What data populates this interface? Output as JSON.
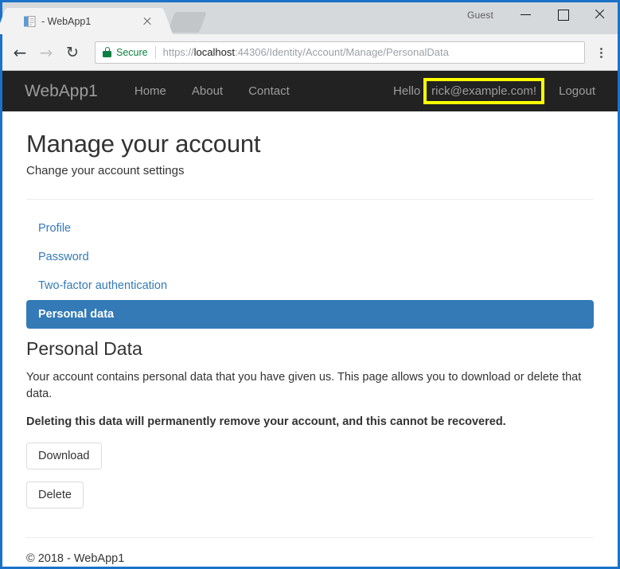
{
  "browser": {
    "tab": {
      "title": "- WebApp1",
      "favicon": "page-icon",
      "close_icon": "close-icon"
    },
    "newtab_icon": "new-tab-button",
    "window": {
      "profile_label": "Guest",
      "minimize_icon": "minimize-icon",
      "maximize_icon": "maximize-icon",
      "close_icon": "close-icon"
    },
    "toolbar": {
      "back_icon": "←",
      "forward_icon": "→",
      "reload_icon": "↻",
      "menu_icon": "overflow-menu-icon",
      "security_label": "Secure",
      "lock_icon": "lock-icon",
      "url_scheme": "https://",
      "url_host": "localhost",
      "url_path": ":44306/Identity/Account/Manage/PersonalData",
      "url_full": "https://localhost:44306/Identity/Account/Manage/PersonalData"
    }
  },
  "site": {
    "navbar": {
      "brand": "WebApp1",
      "links": [
        {
          "label": "Home"
        },
        {
          "label": "About"
        },
        {
          "label": "Contact"
        }
      ],
      "greeting_prefix": "Hello",
      "user_email": "rick@example.com!",
      "logout_label": "Logout",
      "highlight_color": "#ffff00",
      "background_color": "#222222"
    },
    "header": {
      "title": "Manage your account",
      "subtitle": "Change your account settings"
    },
    "manage_nav": {
      "items": [
        {
          "label": "Profile",
          "active": false
        },
        {
          "label": "Password",
          "active": false
        },
        {
          "label": "Two-factor authentication",
          "active": false
        },
        {
          "label": "Personal data",
          "active": true
        }
      ],
      "active_color": "#337ab7",
      "link_color": "#337ab7"
    },
    "main": {
      "section_title": "Personal Data",
      "paragraph": "Your account contains personal data that you have given us. This page allows you to download or delete that data.",
      "warning": "Deleting this data will permanently remove your account, and this cannot be recovered.",
      "download_button": "Download",
      "delete_button": "Delete"
    },
    "footer": {
      "text": "© 2018 - WebApp1"
    }
  }
}
